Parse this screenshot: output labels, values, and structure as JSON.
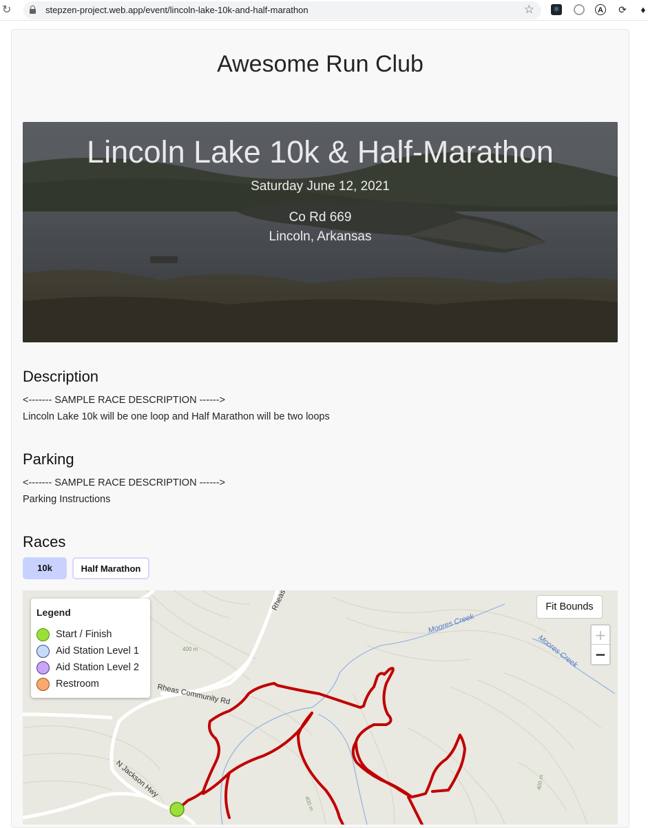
{
  "browser": {
    "url": "stepzen-project.web.app/event/lincoln-lake-10k-and-half-marathon",
    "reload_icon": "reload-icon",
    "star_icon": "star-icon"
  },
  "club": {
    "title": "Awesome Run Club"
  },
  "event": {
    "title": "Lincoln Lake 10k & Half-Marathon",
    "date": "Saturday June 12, 2021",
    "address_line1": "Co Rd 669",
    "address_line2": "Lincoln, Arkansas"
  },
  "description": {
    "heading": "Description",
    "line1": "<------- SAMPLE RACE DESCRIPTION ------>",
    "line2": "Lincoln Lake 10k will be one loop and Half Marathon will be two loops"
  },
  "parking": {
    "heading": "Parking",
    "line1": "<------- SAMPLE RACE DESCRIPTION ------>",
    "line2": "Parking Instructions"
  },
  "races": {
    "heading": "Races",
    "tabs": [
      {
        "label": "10k",
        "selected": true
      },
      {
        "label": "Half Marathon",
        "selected": false
      }
    ]
  },
  "map": {
    "fit_bounds_label": "Fit Bounds",
    "zoom_in_label": "+",
    "zoom_out_label": "−",
    "legend": {
      "title": "Legend",
      "items": [
        {
          "label": "Start / Finish",
          "color": "#9be03a"
        },
        {
          "label": "Aid Station Level 1",
          "color": "#c5dcfb"
        },
        {
          "label": "Aid Station Level 2",
          "color": "#c9a6f5"
        },
        {
          "label": "Restroom",
          "color": "#f9a870"
        }
      ]
    },
    "labels": {
      "rheas_community_rd": "Rheas Community Rd",
      "rheas": "Rheas",
      "n_jackson_hwy": "N Jackson Hwy",
      "moores_creek_1": "Moores Creek",
      "moores_creek_2": "Moores Creek",
      "contour_400a": "400 m",
      "contour_400b": "400 m",
      "contour_400c": "400 m"
    },
    "route_color": "#c00000",
    "creek_color": "#8fb4e0"
  }
}
